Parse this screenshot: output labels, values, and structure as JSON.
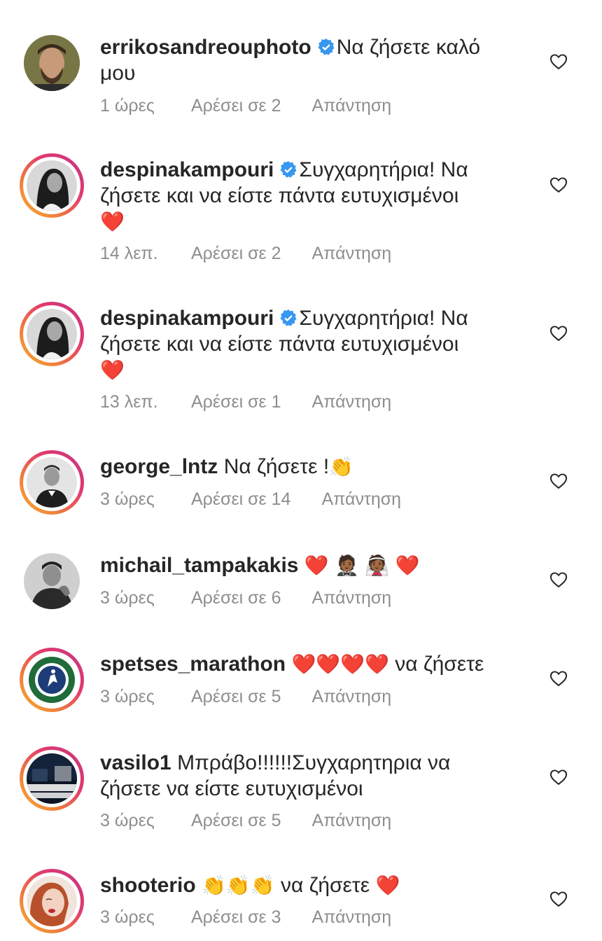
{
  "colors": {
    "text": "#262626",
    "meta": "#8e8e8e",
    "verified": "#3897f0",
    "heart_red": "#e0262e",
    "ring_gradient": [
      "#f9b233",
      "#e3396e",
      "#c13584"
    ]
  },
  "comments": [
    {
      "username": "errikosandreouphoto",
      "verified": true,
      "text_parts": [
        "Να ζήσετε καλό",
        "μου"
      ],
      "time": "1 ώρες",
      "likes": "Αρέσει σε 2",
      "reply": "Απάντηση",
      "avatar": "avatar-bearded-man"
    },
    {
      "username": "despinakampouri",
      "verified": true,
      "text_parts": [
        "Συγχαρητήρια! Να",
        "ζήσετε και να είστε πάντα ευτυχισμένοι",
        "❤️"
      ],
      "time": "14 λεπ.",
      "likes": "Αρέσει σε 2",
      "reply": "Απάντηση",
      "avatar": "avatar-woman-bw"
    },
    {
      "username": "despinakampouri",
      "verified": true,
      "text_parts": [
        "Συγχαρητήρια! Να",
        "ζήσετε και να είστε πάντα ευτυχισμένοι",
        "❤️"
      ],
      "time": "13 λεπ.",
      "likes": "Αρέσει σε 1",
      "reply": "Απάντηση",
      "avatar": "avatar-woman-bw"
    },
    {
      "username": "george_lntz",
      "verified": false,
      "text_parts": [
        "Να ζήσετε !",
        "👏"
      ],
      "time": "3 ώρες",
      "likes": "Αρέσει σε 14",
      "reply": "Απάντηση",
      "avatar": "avatar-man-tuxedo"
    },
    {
      "username": "michail_tampakakis",
      "verified": false,
      "text_parts": [
        "❤️",
        "🤵🏾",
        "👰🏾",
        "❤️"
      ],
      "time": "3 ώρες",
      "likes": "Αρέσει σε 6",
      "reply": "Απάντηση",
      "avatar": "avatar-man-bw"
    },
    {
      "username": "spetses_marathon",
      "verified": false,
      "text_parts": [
        "❤️❤️❤️❤️",
        "να ζήσετε"
      ],
      "time": "3 ώρες",
      "likes": "Αρέσει σε 5",
      "reply": "Απάντηση",
      "avatar": "avatar-marathon-logo"
    },
    {
      "username": "vasilo1",
      "verified": false,
      "text_parts": [
        "Μπράβο!!!!!!Συγχαρητηρια να",
        "ζήσετε να είστε ευτυχισμένοι"
      ],
      "time": "3 ώρες",
      "likes": "Αρέσει σε 5",
      "reply": "Απάντηση",
      "avatar": "avatar-american-dream"
    },
    {
      "username": "shooterio",
      "verified": false,
      "text_parts": [
        "👏👏👏",
        "να ζήσετε",
        "❤️"
      ],
      "time": "3 ώρες",
      "likes": "Αρέσει σε 3",
      "reply": "Απάντηση",
      "avatar": "avatar-redhead-woman"
    }
  ],
  "icons": {
    "verified": "verified-badge-icon",
    "like": "heart-outline-icon"
  }
}
